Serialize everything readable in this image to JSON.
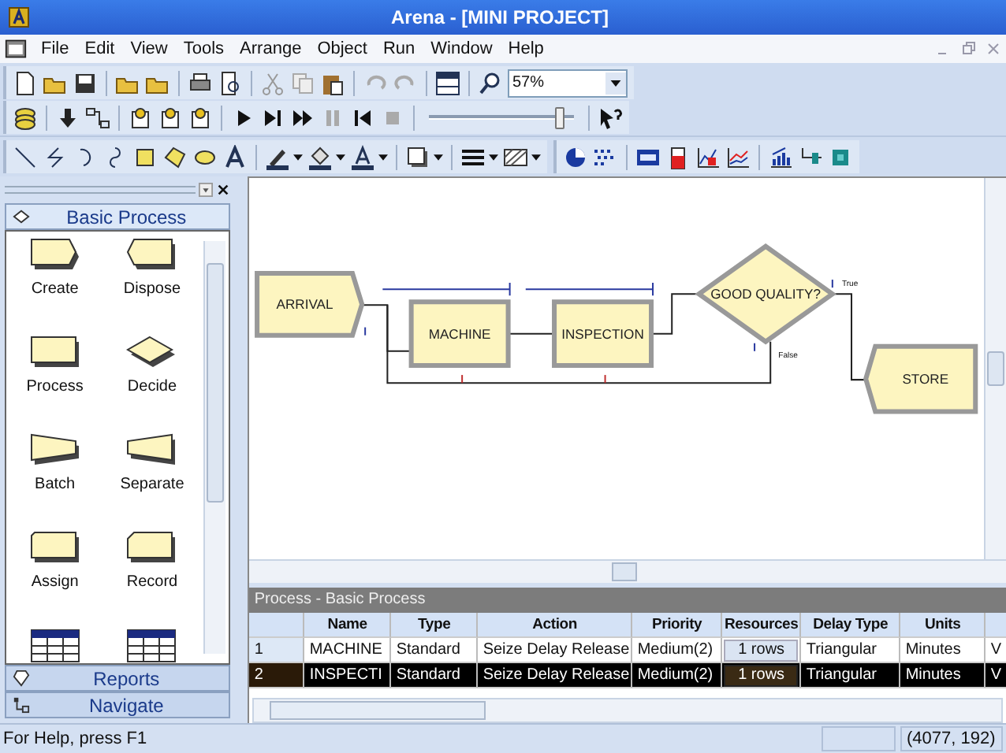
{
  "window": {
    "title": "Arena - [MINI PROJECT]"
  },
  "menu": [
    "File",
    "Edit",
    "View",
    "Tools",
    "Arrange",
    "Object",
    "Run",
    "Window",
    "Help"
  ],
  "toolbar": {
    "zoom": "57%",
    "speed_slider": {
      "level": 0.95
    }
  },
  "project_bar": {
    "panels": [
      {
        "label": "Basic Process",
        "expanded": true,
        "modules": [
          {
            "kind": "create",
            "label": "Create"
          },
          {
            "kind": "dispose",
            "label": "Dispose"
          },
          {
            "kind": "process",
            "label": "Process"
          },
          {
            "kind": "decide",
            "label": "Decide"
          },
          {
            "kind": "batch",
            "label": "Batch"
          },
          {
            "kind": "separate",
            "label": "Separate"
          },
          {
            "kind": "assign",
            "label": "Assign"
          },
          {
            "kind": "record",
            "label": "Record"
          },
          {
            "kind": "table"
          },
          {
            "kind": "table"
          }
        ]
      },
      {
        "label": "Reports",
        "expanded": false
      },
      {
        "label": "Navigate",
        "expanded": false
      }
    ]
  },
  "flowchart": {
    "nodes": [
      {
        "kind": "create",
        "label": "ARRIVAL"
      },
      {
        "kind": "process",
        "label": "MACHINE"
      },
      {
        "kind": "process",
        "label": "INSPECTION"
      },
      {
        "kind": "decide",
        "label": "GOOD QUALITY?"
      },
      {
        "kind": "dispose",
        "label": "STORE"
      }
    ],
    "branch_labels": [
      "True",
      "False"
    ]
  },
  "spreadsheet": {
    "title": "Process - Basic Process",
    "columns": [
      "Name",
      "Type",
      "Action",
      "Priority",
      "Resources",
      "Delay Type",
      "Units"
    ],
    "rows": [
      {
        "number": "1",
        "selected": false,
        "cells": [
          "MACHINE",
          "Standard",
          "Seize Delay Release",
          "Medium(2)",
          "1 rows",
          "Triangular",
          "Minutes",
          "V"
        ]
      },
      {
        "number": "2",
        "selected": true,
        "cells": [
          "INSPECTI",
          "Standard",
          "Seize Delay Release",
          "Medium(2)",
          "1 rows",
          "Triangular",
          "Minutes",
          "V"
        ]
      }
    ]
  },
  "status_bar": {
    "help": "For Help, press F1",
    "coordinates": "(4077, 192)"
  }
}
